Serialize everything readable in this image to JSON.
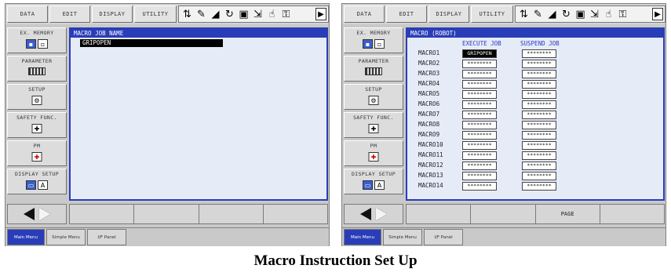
{
  "left": {
    "menubar": [
      "DATA",
      "EDIT",
      "DISPLAY",
      "UTILITY"
    ],
    "side": {
      "ex_memory": "EX. MEMORY",
      "parameter": "PARAMETER",
      "setup": "SETUP",
      "safety": "SAFETY FUNC.",
      "pm": "PM",
      "display_setup": "DISPLAY SETUP"
    },
    "main_title": "MACRO JOB NAME",
    "job_name": "GRIPOPEN",
    "softkeys": [
      "",
      "",
      "",
      ""
    ],
    "taskbar": [
      "Main Menu",
      "Simple Menu",
      "I/F Panel"
    ]
  },
  "right": {
    "menubar": [
      "DATA",
      "EDIT",
      "DISPLAY",
      "UTILITY"
    ],
    "side": {
      "ex_memory": "EX. MEMORY",
      "parameter": "PARAMETER",
      "setup": "SETUP",
      "safety": "SAFETY FUNC.",
      "pm": "PM",
      "display_setup": "DISPLAY SETUP"
    },
    "main_title": "MACRO (ROBOT)",
    "col_execute": "EXECUTE JOB",
    "col_suspend": "SUSPEND JOB",
    "macros": [
      {
        "label": "MACRO1",
        "execute": "GRIPOPEN",
        "suspend": "********"
      },
      {
        "label": "MACRO2",
        "execute": "********",
        "suspend": "********"
      },
      {
        "label": "MACRO3",
        "execute": "********",
        "suspend": "********"
      },
      {
        "label": "MACRO4",
        "execute": "********",
        "suspend": "********"
      },
      {
        "label": "MACRO5",
        "execute": "********",
        "suspend": "********"
      },
      {
        "label": "MACRO6",
        "execute": "********",
        "suspend": "********"
      },
      {
        "label": "MACRO7",
        "execute": "********",
        "suspend": "********"
      },
      {
        "label": "MACRO8",
        "execute": "********",
        "suspend": "********"
      },
      {
        "label": "MACRO9",
        "execute": "********",
        "suspend": "********"
      },
      {
        "label": "MACRO10",
        "execute": "********",
        "suspend": "********"
      },
      {
        "label": "MACRO11",
        "execute": "********",
        "suspend": "********"
      },
      {
        "label": "MACRO12",
        "execute": "********",
        "suspend": "********"
      },
      {
        "label": "MACRO13",
        "execute": "********",
        "suspend": "********"
      },
      {
        "label": "MACRO14",
        "execute": "********",
        "suspend": "********"
      }
    ],
    "softkeys": [
      "",
      "",
      "PAGE",
      ""
    ],
    "taskbar": [
      "Main Menu",
      "Simple Menu",
      "I/F Panel"
    ]
  },
  "status_icons": [
    "axis-icon",
    "edit-mode-icon",
    "signal-icon",
    "cycle-icon",
    "io-icon",
    "teach-icon",
    "hand-icon",
    "key-icon"
  ],
  "caption": "Macro Instruction Set Up"
}
